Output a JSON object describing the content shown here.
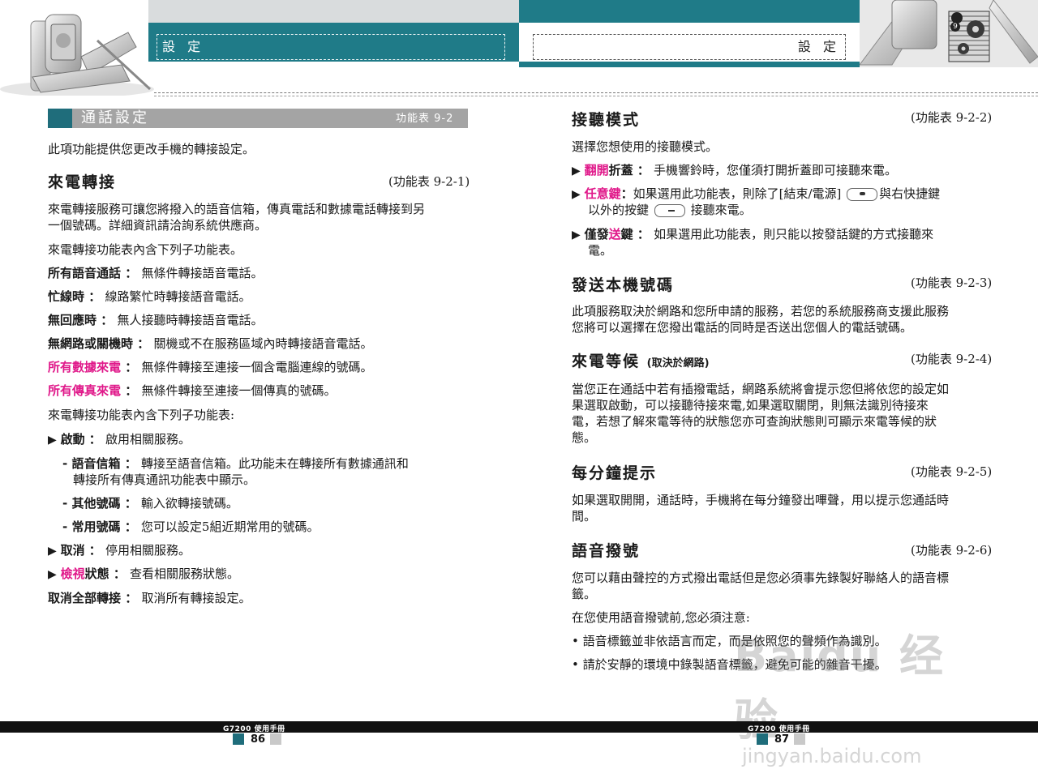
{
  "header": {
    "left_title": "設 定",
    "right_title": "設 定",
    "badge": "9"
  },
  "left": {
    "section_title": "通話設定",
    "section_menu": "功能表 9-2",
    "intro": "此項功能提供您更改手機的轉接設定。",
    "call_forward": {
      "heading": "來電轉接",
      "menu": "(功能表 9-2-1)",
      "desc_line1": "來電轉接服務可讓您將撥入的語音信箱，傳真電話和數據電話轉接到另",
      "desc_line2": "一個號碼。詳細資訊請洽詢系統供應商。",
      "sub_intro": "來電轉接功能表內含下列子功能表。",
      "items": [
        {
          "label": "所有語音通話",
          "sep": " ： ",
          "text": "無條件轉接語音電話。"
        },
        {
          "label": "忙線時",
          "sep": " ： ",
          "text": "線路繁忙時轉接語音電話。"
        },
        {
          "label": "無回應時",
          "sep": " ： ",
          "text": "無人接聽時轉接語音電話。"
        },
        {
          "label": "無網路或關機時",
          "sep": " ： ",
          "text": "關機或不在服務區域內時轉接語音電話。"
        },
        {
          "label": "所有數據來電",
          "sep": " ： ",
          "text": "無條件轉接至連接一個含電腦連線的號碼。"
        },
        {
          "label": "所有傳真來電",
          "sep": " ： ",
          "text": "無條件轉接至連接一個傳真的號碼。"
        }
      ],
      "sub_intro2": "來電轉接功能表內含下列子功能表:",
      "activate": {
        "label": "啟動",
        "sep": " ： ",
        "text": "啟用相關服務。"
      },
      "sub_items": [
        {
          "label": "語音信箱",
          "sep": " ： ",
          "text": "轉接至語音信箱。此功能未在轉接所有數據通訊和",
          "text2": "轉接所有傳真通訊功能表中顯示。"
        },
        {
          "label": "其他號碼",
          "sep": " ： ",
          "text": "輸入欲轉接號碼。"
        },
        {
          "label": "常用號碼",
          "sep": " ： ",
          "text": "您可以設定5組近期常用的號碼。"
        }
      ],
      "cancel": {
        "label": "取消",
        "sep": " ： ",
        "text": "停用相關服務。"
      },
      "check": {
        "label_a": "檢視",
        "label_b": "狀態",
        "sep": " ： ",
        "text": "查看相關服務狀態。"
      },
      "cancel_all": {
        "label": "取消全部轉接",
        "sep": " ： ",
        "text": "取消所有轉接設定。"
      }
    }
  },
  "right": {
    "answer_mode": {
      "heading": "接聽模式",
      "menu": "(功能表 9-2-2)",
      "intro": "選擇您想使用的接聽模式。",
      "flip": {
        "label_a": "翻開",
        "label_b": "折蓋",
        "sep": " ： ",
        "text": "手機響鈴時，您僅須打開折蓋即可接聽來電。"
      },
      "any_key": {
        "label": "任意鍵",
        "sep": "：",
        "text_a": "如果選用此功能表，則除了[結束/電源]",
        "text_b": "與右快捷鍵",
        "text2_a": "以外的按鍵",
        "text2_b": "接聽來電。"
      },
      "send_only": {
        "label_a": "僅發",
        "label_b": "送",
        "label_c": "鍵",
        "sep": " ： ",
        "text": "如果選用此功能表，則只能以按發話鍵的方式接聽來",
        "text2": "電。"
      }
    },
    "send_number": {
      "heading": "發送本機號碼",
      "menu": "(功能表 9-2-3)",
      "line1": "此項服務取決於網路和您所申請的服務，若您的系統服務商支援此服務",
      "line2": "您將可以選擇在您撥出電話的同時是否送出您個人的電話號碼。"
    },
    "call_waiting": {
      "heading": "來電等候",
      "note": "(取決於網路)",
      "menu": "(功能表 9-2-4)",
      "line1": "當您正在通話中若有插撥電話，網路系統將會提示您但將依您的設定如",
      "line2": "果選取啟動，可以接聽待接來電,如果選取關閉，則無法識別待接來",
      "line3": "電，若想了解來電等待的狀態您亦可查詢狀態則可顯示來電等候的狀",
      "line4": "態。"
    },
    "minute_minder": {
      "heading": "每分鐘提示",
      "menu": "(功能表 9-2-5)",
      "line1": "如果選取開開，通話時，手機將在每分鐘發出嗶聲，用以提示您通話時",
      "line2": "間。"
    },
    "voice_dial": {
      "heading": "語音撥號",
      "menu": "(功能表 9-2-6)",
      "line1": "您可以藉由聲控的方式撥出電話但是您必須事先錄製好聯絡人的語音標",
      "line2": "籤。",
      "line3": "在您使用語音撥號前,您必須注意:",
      "bullets": [
        "語音標籤並非依語言而定，而是依照您的聲頻作為識別。",
        "請於安靜的環境中錄製語音標籤，避免可能的雜音干擾。"
      ]
    }
  },
  "footer": {
    "left_label": "G7200 使用手冊",
    "left_page": "86",
    "right_label": "G7200 使用手冊",
    "right_page": "87"
  },
  "watermark": {
    "text1": "Baidu 经验",
    "text2": "jingyan.baidu.com"
  },
  "colors": {
    "teal": "#1f7b88",
    "pink": "#e0198a",
    "gray_bar": "#a4a4a4"
  }
}
